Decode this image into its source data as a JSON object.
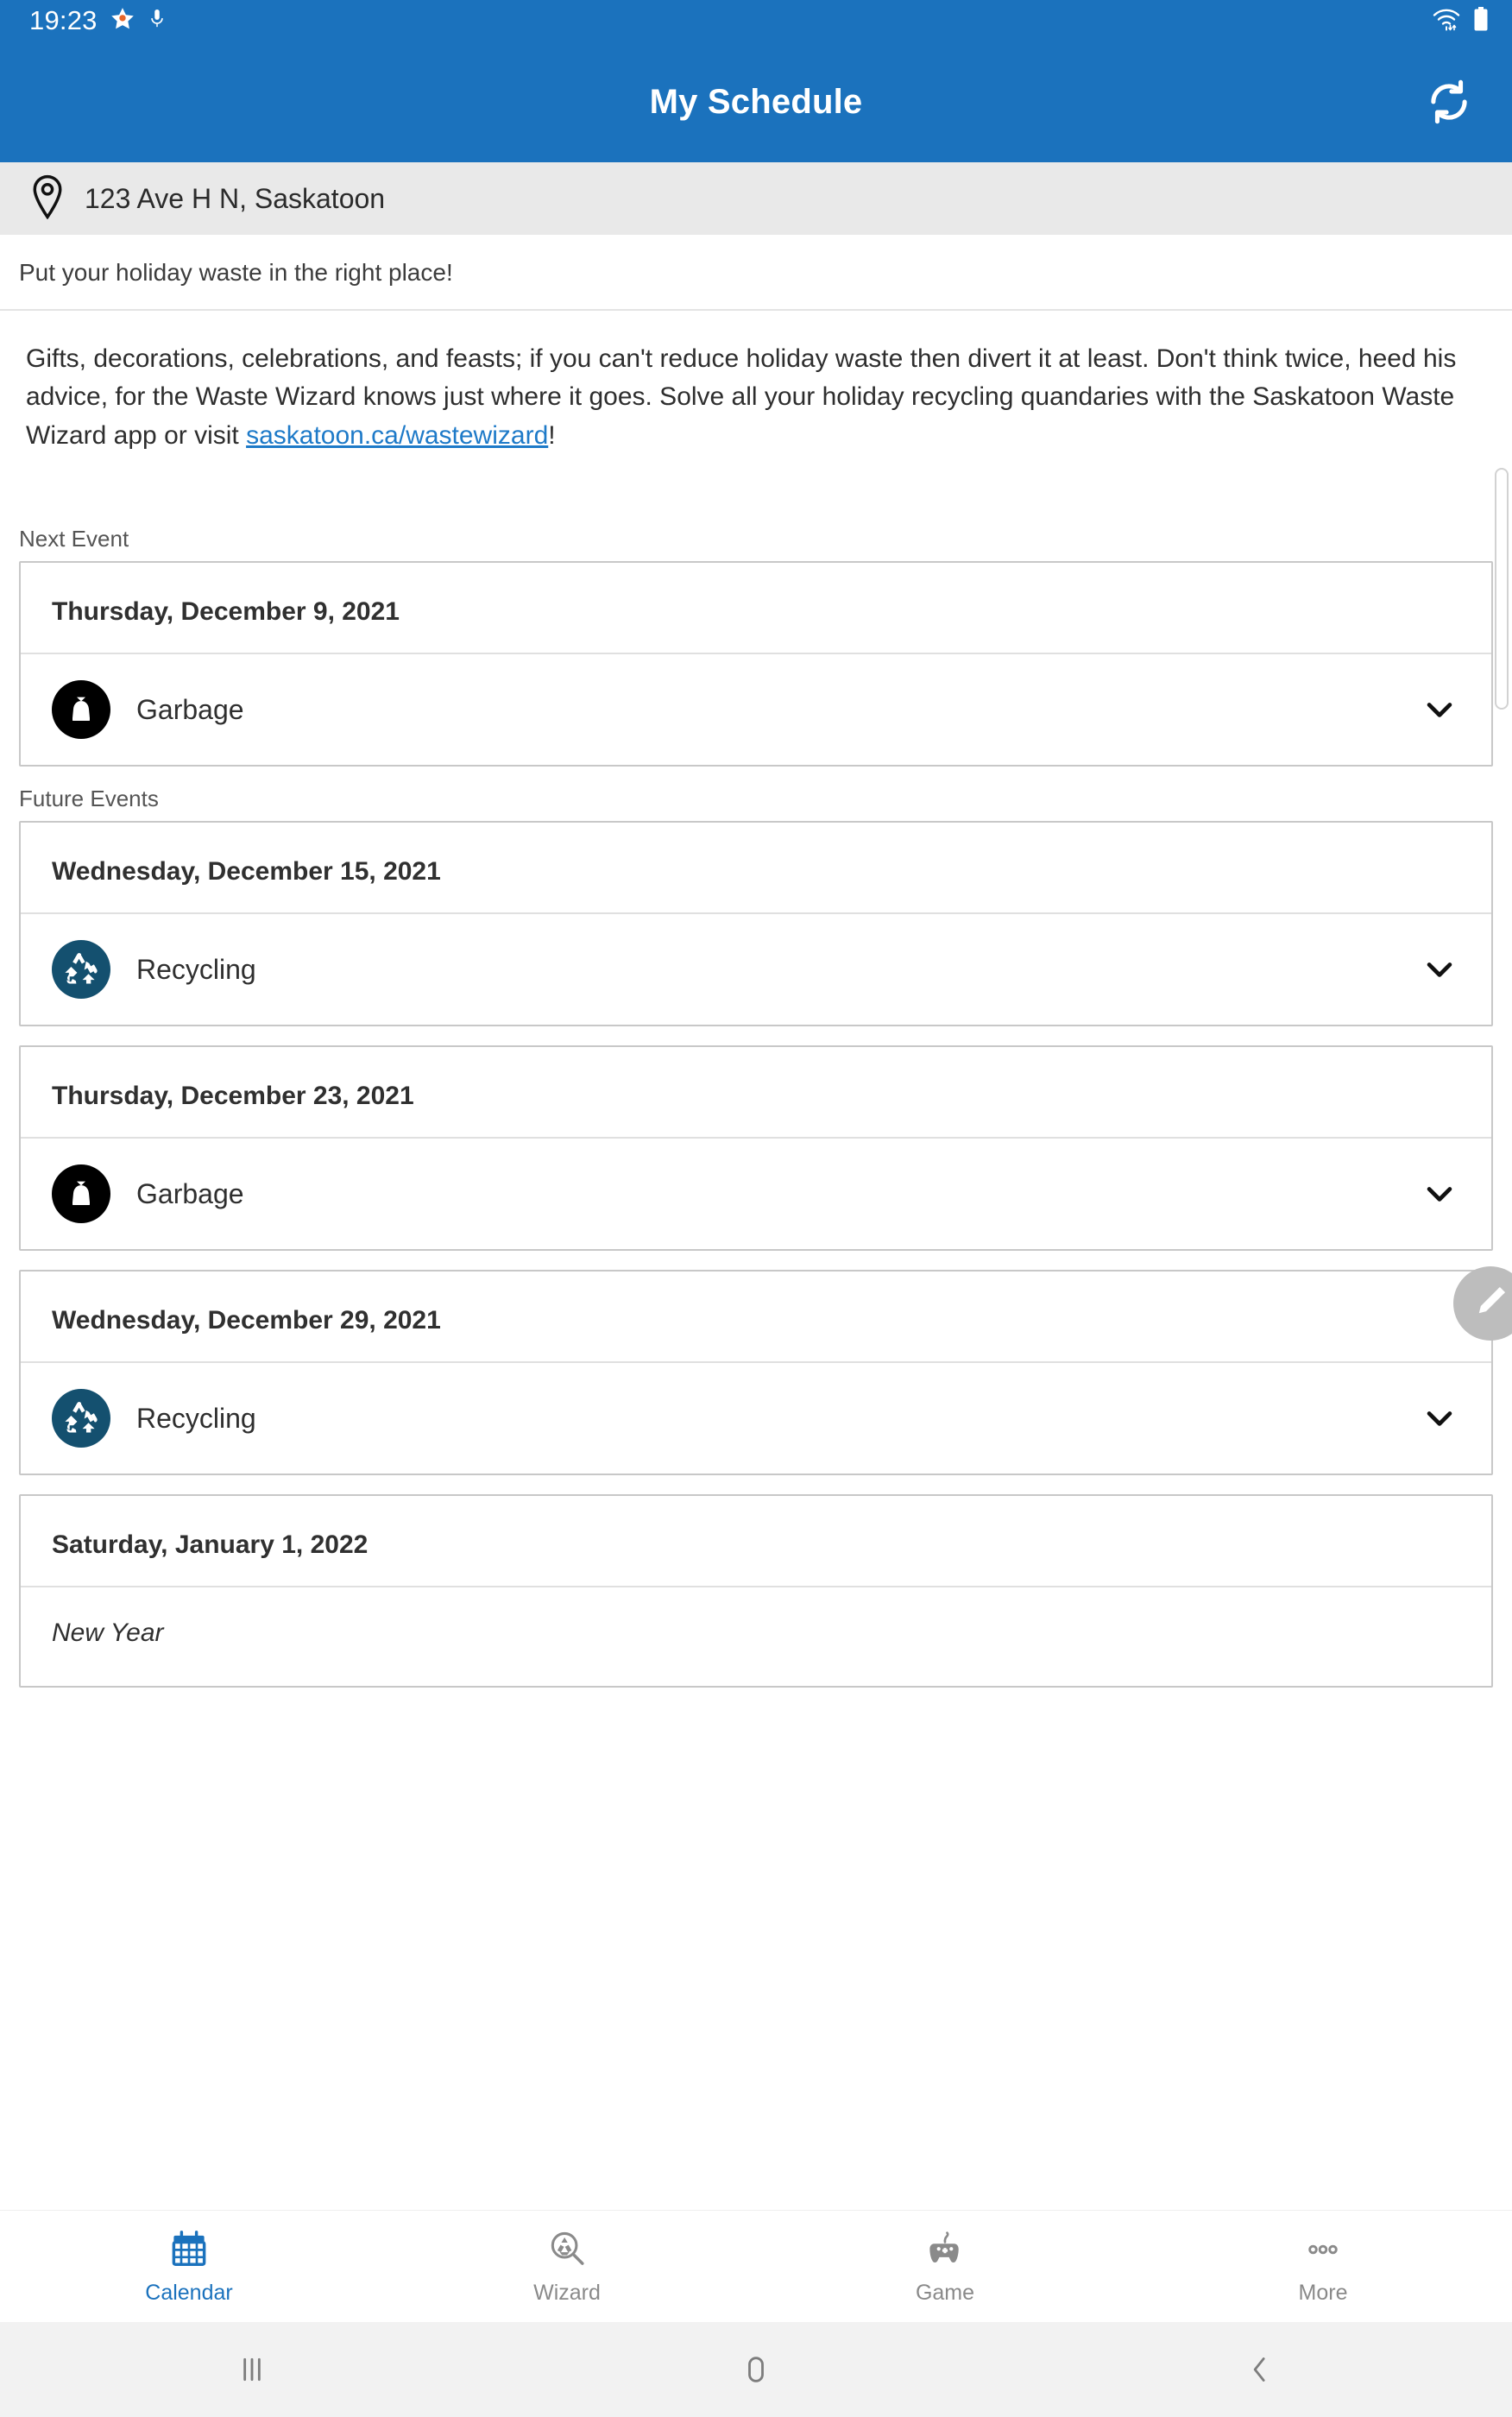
{
  "status_bar": {
    "time": "19:23",
    "icons": [
      "star-icon",
      "microphone-icon",
      "wifi-icon",
      "battery-icon"
    ]
  },
  "app_bar": {
    "title": "My Schedule",
    "refresh_icon": "refresh-icon"
  },
  "address": {
    "icon": "location-pin-icon",
    "text": "123 Ave H  N, Saskatoon"
  },
  "notice": {
    "headline": "Put your holiday waste in the right place!",
    "body_before_link": "Gifts, decorations, celebrations, and feasts; if you can't reduce holiday waste then divert it at least. Don't think twice, heed his advice, for the Waste Wizard knows just where it goes. Solve all your holiday recycling quandaries with the Saskatoon Waste Wizard app or visit ",
    "link_text": "saskatoon.ca/wastewizard",
    "body_after_link": "!"
  },
  "sections": {
    "next_event_label": "Next Event",
    "future_events_label": "Future Events"
  },
  "next_event": {
    "date": "Thursday, December 9, 2021",
    "type": "Garbage",
    "icon": "garbage-bag-icon",
    "badge_color": "#000000",
    "chevron": "chevron-down-icon"
  },
  "future_events": [
    {
      "date": "Wednesday, December 15, 2021",
      "type": "Recycling",
      "icon": "recycling-icon",
      "badge_color": "#14506f",
      "chevron": "chevron-down-icon"
    },
    {
      "date": "Thursday, December 23, 2021",
      "type": "Garbage",
      "icon": "garbage-bag-icon",
      "badge_color": "#000000",
      "chevron": "chevron-down-icon"
    },
    {
      "date": "Wednesday, December 29, 2021",
      "type": "Recycling",
      "icon": "recycling-icon",
      "badge_color": "#14506f",
      "chevron": "chevron-down-icon"
    }
  ],
  "holiday_event": {
    "date": "Saturday, January 1, 2022",
    "name": "New Year"
  },
  "fab": {
    "icon": "pencil-edit-icon"
  },
  "tab_bar": {
    "active": "Calendar",
    "accent_color": "#1b72bd",
    "inactive_color": "#8a8a8a",
    "tabs": [
      {
        "label": "Calendar",
        "icon": "calendar-icon"
      },
      {
        "label": "Wizard",
        "icon": "magnifier-recycle-icon"
      },
      {
        "label": "Game",
        "icon": "gamepad-icon"
      },
      {
        "label": "More",
        "icon": "more-dots-icon"
      }
    ]
  },
  "android_nav": {
    "buttons": [
      {
        "icon": "recents-icon"
      },
      {
        "icon": "home-icon"
      },
      {
        "icon": "back-icon"
      }
    ]
  }
}
